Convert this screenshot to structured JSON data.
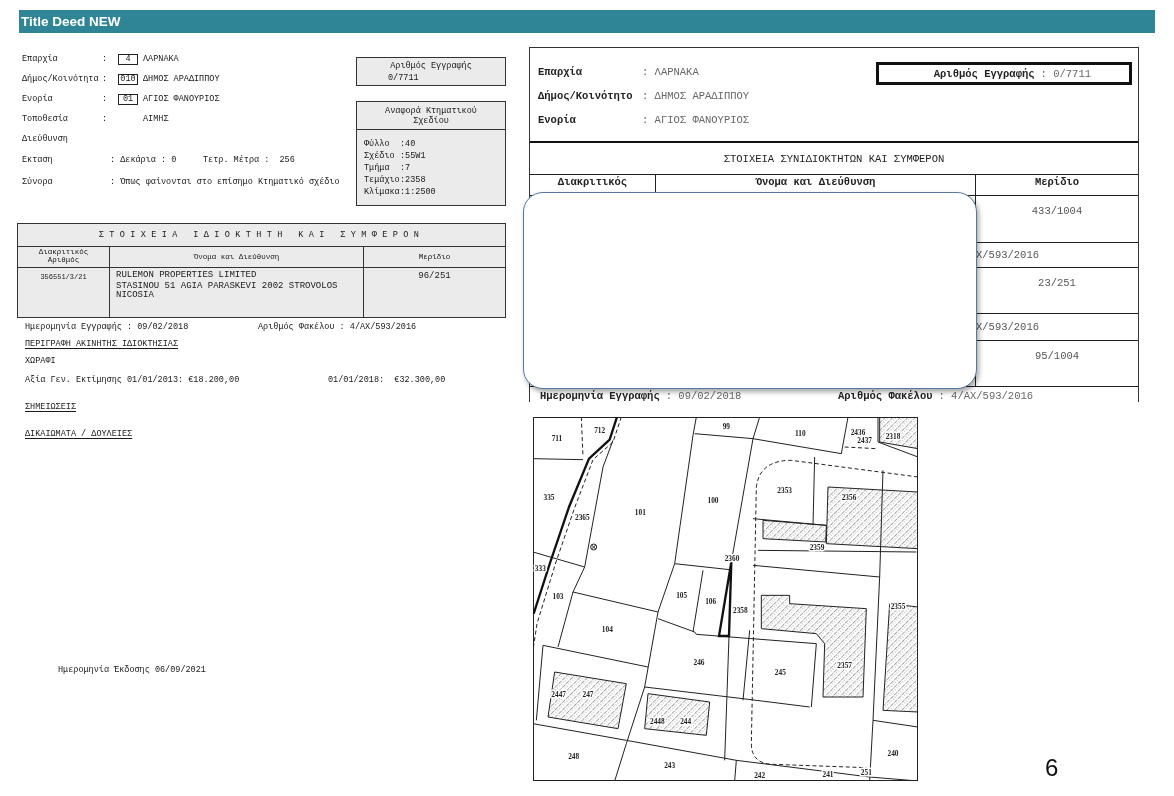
{
  "title": "Title Deed NEW",
  "left_document": {
    "fields": [
      {
        "kind": "coded",
        "label": "Επαρχία",
        "sep": ":",
        "code": "4",
        "value": "ΛΑΡΝΑΚΑ"
      },
      {
        "kind": "coded",
        "label": "Δήμος/Κοινότητα",
        "sep": ":",
        "code": "010",
        "value": "ΔΗΜΟΣ ΑΡΑΔΙΠΠΟΥ"
      },
      {
        "kind": "coded",
        "label": "Ενορία",
        "sep": ":",
        "code": "01",
        "value": "ΑΓΙΟΣ ΦΑΝΟΥΡΙΟΣ"
      },
      {
        "kind": "coded",
        "label": "Τοποθεσία",
        "sep": ":",
        "value": "ΑΙΜΗΣ"
      },
      {
        "kind": "plain",
        "label": "Διεύθυνση"
      },
      {
        "kind": "plain",
        "label": "Εκταση",
        "value": ": Δεκάρια : 0",
        "extra": "Τετρ. Μέτρα :  256"
      },
      {
        "kind": "plain",
        "label": "Σύνορα",
        "value": ": Όπως φαίνονται στο επίσημο Κτηματικό σχέδιο"
      }
    ],
    "registration": {
      "title": "Αριθμός Εγγραφής",
      "value": "0/7711"
    },
    "plan_reference": {
      "title": "Αναφορά Κτηματικού Σχεδίου",
      "rows": [
        {
          "label": "Φύλλο",
          "value": ":40"
        },
        {
          "label": "Σχέδιο",
          "value": ":55W1"
        },
        {
          "label": "Τμήμα",
          "value": ":7"
        },
        {
          "label": "Τεμάχιο",
          "value": ":2358"
        },
        {
          "label": "Κλίμακα",
          "value": ":1:2500"
        }
      ]
    },
    "owners_table": {
      "title": "ΣΤΟΙΧΕΙΑ ΙΔΙΟΚΤΗΤΗ ΚΑΙ ΣΥΜΦΕΡΟΝ",
      "columns": [
        "Διακριτικός Αριθμός",
        "Όνομα και Διεύθυνση",
        "Μερίδιο"
      ],
      "rows": [
        {
          "id": "356551/3/21",
          "name": "RULEMON PROPERTIES LIMITED",
          "address": "STASINOU 51 AGIA PARASKEVI 2002 STROVOLOS NICOSIA",
          "share": "96/251"
        }
      ]
    },
    "record_line": [
      "Ημερομηνία Εγγραφής : 09/02/2018",
      "Αριθμός Φακέλου : 4/ΑΧ/593/2016"
    ],
    "description_heading": "ΠΕΡΙΓΡΑΦΗ ΑΚΙΝΗΤΗΣ ΙΔΙΟΚΤΗΣΙΑΣ",
    "description": "ΧΩΡΑΦΙ",
    "valuation": [
      "Αξία Γεν. Εκτίμησης 01/01/2013: €18.200,00",
      "01/01/2018:  €32.300,00"
    ],
    "notes_heading": "ΣΗΜΕΙΩΣΕΙΣ",
    "rights_heading": "ΔΙΚΑΙΩΜΑΤΑ / ΔΟΥΛΕΙΕΣ",
    "issue_date": "Ημερομηνία Έκδοσης 06/09/2021"
  },
  "right_document": {
    "fields": [
      {
        "label": "Επαρχία",
        "value": ": ΛΑΡΝΑΚΑ"
      },
      {
        "label": "Δήμος/Κοινότητο",
        "value": ": ΔΗΜΟΣ ΑΡΑΔΙΠΠΟΥ"
      },
      {
        "label": "Ενορία",
        "value": ": ΑΓΙΟΣ ΦΑΝΟΥΡΙΟΣ"
      }
    ],
    "registration": {
      "label": "Αριθμός Εγγραφής",
      "value": ": 0/7711"
    },
    "table_title": "ΣΤΟΙΧΕΙΑ ΣΥΝΙΔΙΟΚΤΗΤΩΝ ΚΑΙ ΣΥΜΦΕΡΟΝ",
    "columns": [
      "Διακριτικός",
      "Όνομα και Διεύθυνση",
      "Μερίδιο"
    ],
    "rows": [
      {
        "kind": "share",
        "text": "433/1004"
      },
      {
        "kind": "file",
        "text": "Χ/593/2016"
      },
      {
        "kind": "share",
        "text": "23/251"
      },
      {
        "kind": "file",
        "text": "Χ/593/2016"
      },
      {
        "kind": "share",
        "text": "95/1004"
      }
    ],
    "footer": [
      {
        "label": "Ημερομηνία Εγγραφής",
        "value": ": 09/02/2018"
      },
      {
        "label": "Αριθμός Φακέλου",
        "value": ": 4/ΑΧ/593/2016"
      }
    ]
  },
  "map": {
    "parcel_labels": [
      "711",
      "712",
      "99",
      "110",
      "2436",
      "2437",
      "2318",
      "335",
      "2365",
      "101",
      "100",
      "2353",
      "2356",
      "2359",
      "2360",
      "333",
      "103",
      "105",
      "106",
      "2358",
      "104",
      "246",
      "245",
      "2357",
      "2355",
      "2447",
      "247",
      "2448",
      "244",
      "248",
      "243",
      "242",
      "241",
      "251",
      "240"
    ]
  },
  "page_number": "6"
}
